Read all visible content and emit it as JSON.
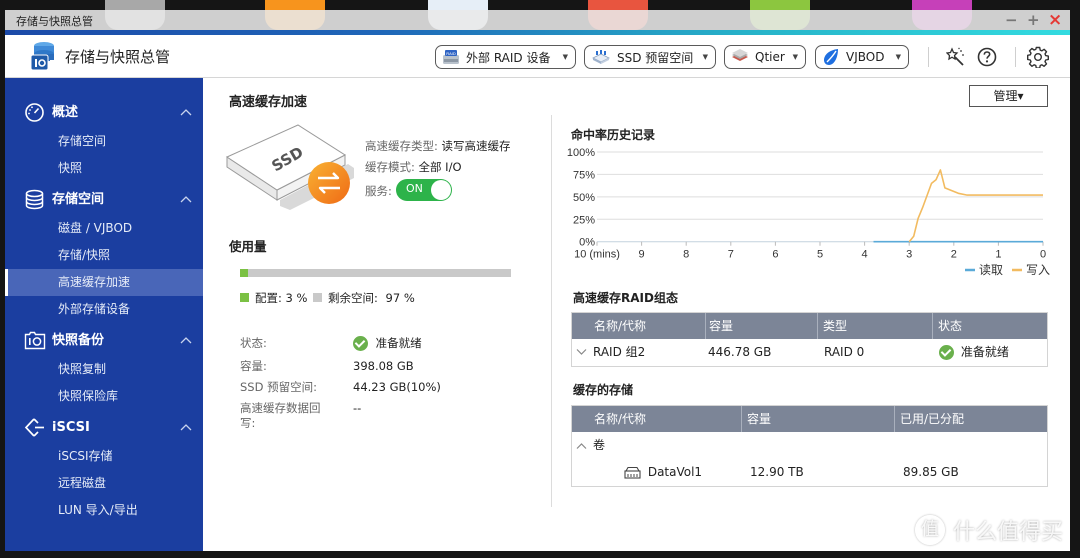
{
  "desktop": {
    "icons": [
      {
        "name": "control-panel-app-icon",
        "color": "#a8a8a8"
      },
      {
        "name": "file-station-app-icon",
        "color": "#f7941d"
      },
      {
        "name": "storage-app-icon",
        "color": "#e6eef7"
      },
      {
        "name": "app-center-icon",
        "color": "#e8553f"
      },
      {
        "name": "helpdesk-app-icon",
        "color": "#8cc63f"
      },
      {
        "name": "hybrid-backup-app-icon",
        "color": "#c640b9"
      }
    ]
  },
  "window": {
    "title": "存储与快照总管",
    "minimize": "−",
    "maximize": "+",
    "close": "×"
  },
  "header": {
    "app_title": "存储与快照总管",
    "buttons": [
      {
        "label": "外部 RAID 设备",
        "icon": "raid-device-icon"
      },
      {
        "label": "SSD 预留空间",
        "icon": "ssd-overprovisioning-icon"
      },
      {
        "label": "Qtier",
        "icon": "qtier-icon"
      },
      {
        "label": "VJBOD",
        "icon": "vjbod-icon"
      }
    ],
    "caret": "▼",
    "tools": [
      "wand-icon",
      "help-icon",
      "gear-icon"
    ]
  },
  "sidebar": {
    "sections": [
      {
        "label": "概述",
        "icon": "dashboard-icon",
        "items": [
          "存储空间",
          "快照"
        ]
      },
      {
        "label": "存储空间",
        "icon": "database-icon",
        "items": [
          "磁盘 / VJBOD",
          "存储/快照",
          "高速缓存加速",
          "外部存储设备"
        ]
      },
      {
        "label": "快照备份",
        "icon": "snapshot-backup-icon",
        "items": [
          "快照复制",
          "快照保险库"
        ]
      },
      {
        "label": "iSCSI",
        "icon": "iscsi-icon",
        "items": [
          "iSCSI存储",
          "远程磁盘",
          "LUN 导入/导出"
        ]
      }
    ],
    "active_item": "高速缓存加速"
  },
  "main": {
    "title": "高速缓存加速",
    "manage_button": {
      "label": "管理",
      "caret": "▾"
    },
    "ssd_label": "SSD",
    "cache_info": {
      "type_label": "高速缓存类型:",
      "type_value": "读写高速缓存",
      "mode_label": "缓存模式:",
      "mode_value": "全部 I/O",
      "service_label": "服务:",
      "service_state": "ON",
      "service_on": true
    },
    "usage": {
      "title": "使用量",
      "configured_label": "配置:",
      "configured_value": "3 %",
      "configured_fraction": 0.03,
      "free_label": "剩余空间:",
      "free_value": "97 %"
    },
    "properties": [
      {
        "label": "状态:",
        "value": "准备就绪",
        "status": "ready"
      },
      {
        "label": "容量:",
        "value": "398.08 GB"
      },
      {
        "label": "SSD 预留空间:",
        "value": "44.23 GB(10%)"
      },
      {
        "label": "高速缓存数据回写:",
        "value": "--"
      }
    ],
    "raid_table": {
      "title": "高速缓存RAID组态",
      "columns": [
        "名称/代称",
        "容量",
        "类型",
        "状态"
      ],
      "rows": [
        {
          "name": "RAID 组2",
          "capacity": "446.78 GB",
          "type": "RAID 0",
          "status": "准备就绪"
        }
      ]
    },
    "storage_table": {
      "title": "缓存的存储",
      "columns": [
        "名称/代称",
        "容量",
        "已用/已分配"
      ],
      "groups": [
        {
          "label": "卷",
          "rows": [
            {
              "name": "DataVol1",
              "capacity": "12.90 TB",
              "used": "89.85 GB"
            }
          ]
        }
      ]
    }
  },
  "chart_data": {
    "type": "line",
    "title": "命中率历史记录",
    "xlabel": "mins",
    "ylabel": "",
    "xlim": [
      10,
      0
    ],
    "ylim": [
      0,
      100
    ],
    "x_ticks": [
      10,
      9,
      8,
      7,
      6,
      5,
      4,
      3,
      2,
      1,
      0
    ],
    "x_tick_labels": [
      "10 (mins)",
      "9",
      "8",
      "7",
      "6",
      "5",
      "4",
      "3",
      "2",
      "1",
      "0"
    ],
    "y_ticks": [
      0,
      25,
      50,
      75,
      100
    ],
    "y_tick_labels": [
      "0%",
      "25%",
      "50%",
      "75%",
      "100%"
    ],
    "grid": true,
    "legend": "bottom-right",
    "series": [
      {
        "name": "读取",
        "color": "#5aaad8",
        "x": [
          3.8,
          0
        ],
        "y": [
          0,
          0
        ]
      },
      {
        "name": "写入",
        "color": "#f2bb60",
        "x": [
          3.0,
          2.9,
          2.8,
          2.7,
          2.5,
          2.4,
          2.3,
          2.2,
          1.9,
          1.7,
          0
        ],
        "y": [
          0,
          6,
          26,
          38,
          65,
          69,
          80,
          60,
          54,
          52,
          52
        ]
      }
    ]
  },
  "watermark": {
    "logo": "值",
    "text": "什么值得买"
  },
  "colors": {
    "sidebar_bg": "#1b3ea0",
    "sidebar_active": "#4966b8",
    "toggle_on": "#2db34a",
    "usage_configured": "#7bc144",
    "usage_free": "#c9c9c9",
    "table_header": "#7c8597",
    "status_ready": "#6ab04c",
    "close_red": "#e53935"
  }
}
